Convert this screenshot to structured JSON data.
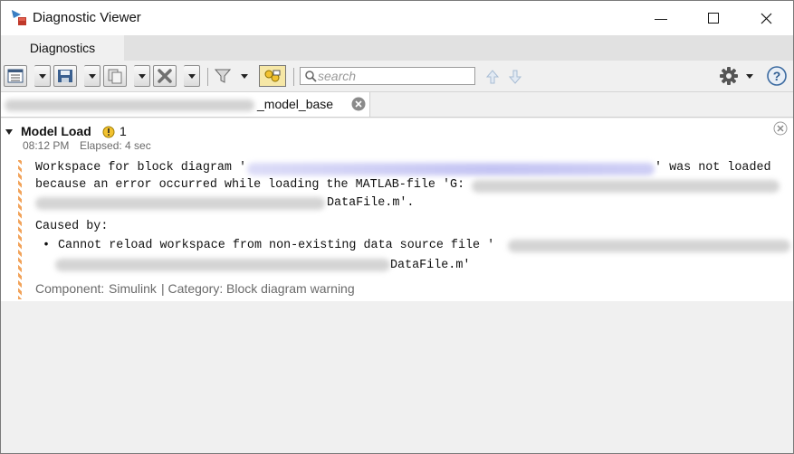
{
  "window": {
    "title": "Diagnostic Viewer",
    "min_glyph": "—",
    "max_glyph": "☐",
    "close_glyph": "✕"
  },
  "tabs": [
    {
      "label": "Diagnostics"
    }
  ],
  "toolbar": {
    "search_placeholder": "search"
  },
  "document_tab": {
    "label": "_model_base"
  },
  "report": {
    "heading": "Model Load",
    "warning_count": "1",
    "time": "08:12 PM",
    "elapsed": "Elapsed: 4 sec",
    "message_line1_start": "Workspace for block diagram '",
    "message_line1_end": "' was not loaded",
    "message_line2": "because an error occurred while loading the MATLAB-file 'G:",
    "message_line3_end": "DataFile.m'.",
    "caused_by": "Caused by:",
    "bullet": "•",
    "cause_text": "Cannot reload workspace from non-existing data source file '",
    "cause_end": "DataFile.m'",
    "component_label": "Component:",
    "component_value": "Simulink",
    "category_label": "| Category:",
    "category_value": "Block diagram warning"
  },
  "colors": {
    "warning": "#f2c230",
    "hatch": "#f2a35a",
    "redaction": "#c9c9f5"
  }
}
